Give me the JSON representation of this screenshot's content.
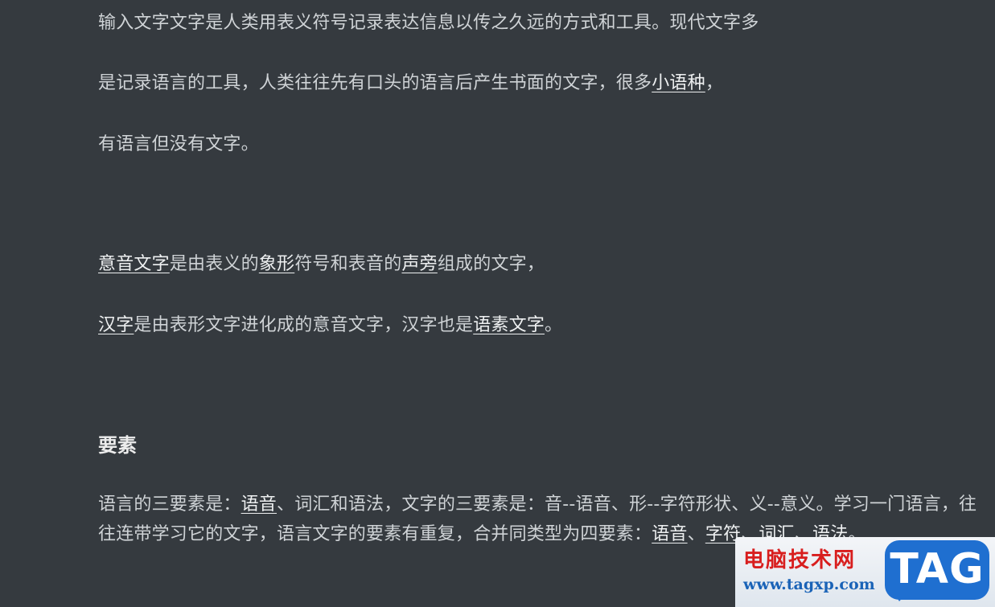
{
  "content": {
    "line1": "输入文字文字是人类用表义符号记录表达信息以传之久远的方式和工具。现代文字多",
    "line2": {
      "before": "是记录语言的工具，人类往往先有口头的语言后产生书面的文字，很多",
      "link": "小语种",
      "after": "，"
    },
    "line3": "有语言但没有文字。",
    "line4": {
      "link1": "意音文字",
      "text1": "是由表义的",
      "link2": "象形",
      "text2": "符号和表音的",
      "link3": "声旁",
      "text3": "组成的文字，"
    },
    "line5": {
      "link1": "汉字",
      "text1": "是由表形文字进化成的意音文字，汉字也是",
      "link2": "语素文字",
      "text2": "。"
    },
    "heading": "要素",
    "para": {
      "t1": "语言的三要素是：",
      "link1": "语音",
      "t2": "、词汇和语法，文字的三要素是：音--语音、形--字符形状、义--意义。学习一门语言，往往连带学习它的文字，语言文字的要素有重复，合并同类型为四要素：",
      "link2": "语音",
      "t3": "、",
      "link3": "字符",
      "t4": "、",
      "link4": "词汇",
      "t5": "、",
      "link5": "语法",
      "t6": "。"
    }
  },
  "watermark": {
    "title": "电脑技术网",
    "url": "www.tagxp.com",
    "badge": "TAG"
  },
  "colors": {
    "background": "#353a3f",
    "text": "#cfd3d6",
    "link": "#eef0f1",
    "watermark_red": "#d81e1e",
    "watermark_blue": "#1f6fd0"
  }
}
